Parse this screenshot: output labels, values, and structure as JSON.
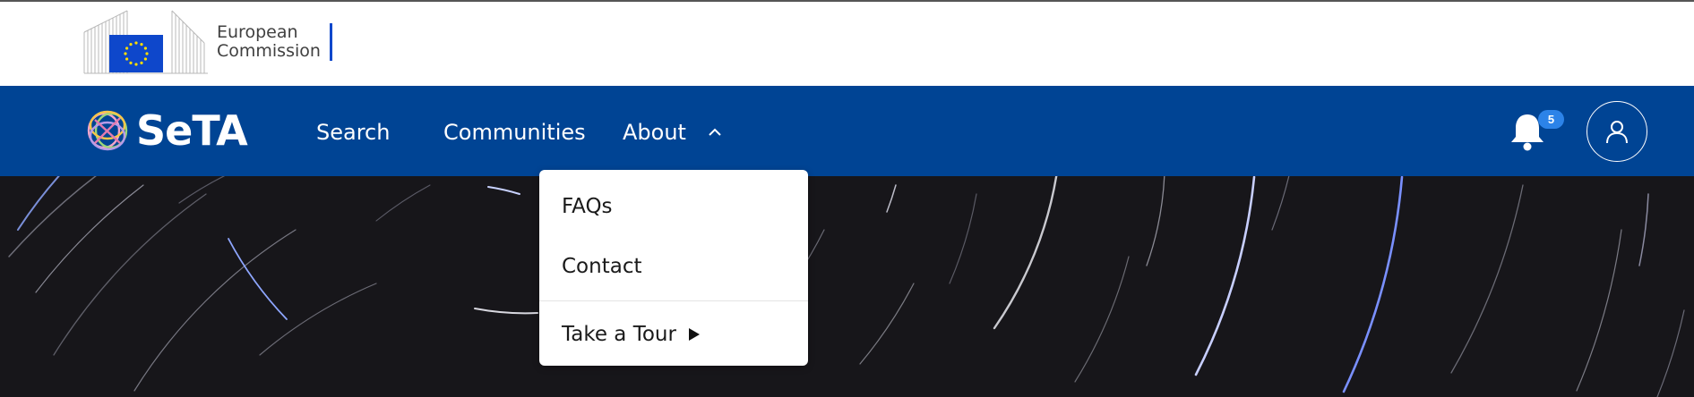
{
  "ec_header": {
    "logo_line1": "European",
    "logo_line2": "Commission",
    "logo_icon": "eu-flag-building-logo"
  },
  "navbar": {
    "brand": "SeTA",
    "brand_icon": "seta-knot-logo",
    "items": [
      {
        "label": "Search"
      },
      {
        "label": "Communities"
      },
      {
        "label": "About",
        "expanded": true,
        "icon": "chevron-up-icon"
      }
    ],
    "notifications": {
      "icon": "bell-icon",
      "count": "5"
    },
    "user": {
      "icon": "user-icon"
    }
  },
  "about_menu": {
    "items": [
      {
        "label": "FAQs"
      },
      {
        "label": "Contact"
      },
      {
        "label": "Take a Tour",
        "icon": "play-icon"
      }
    ]
  },
  "colors": {
    "nav_bg": "#004494",
    "badge_bg": "#2c83e8",
    "hero_bg": "#17161a",
    "ec_accent": "#0e47cb"
  }
}
